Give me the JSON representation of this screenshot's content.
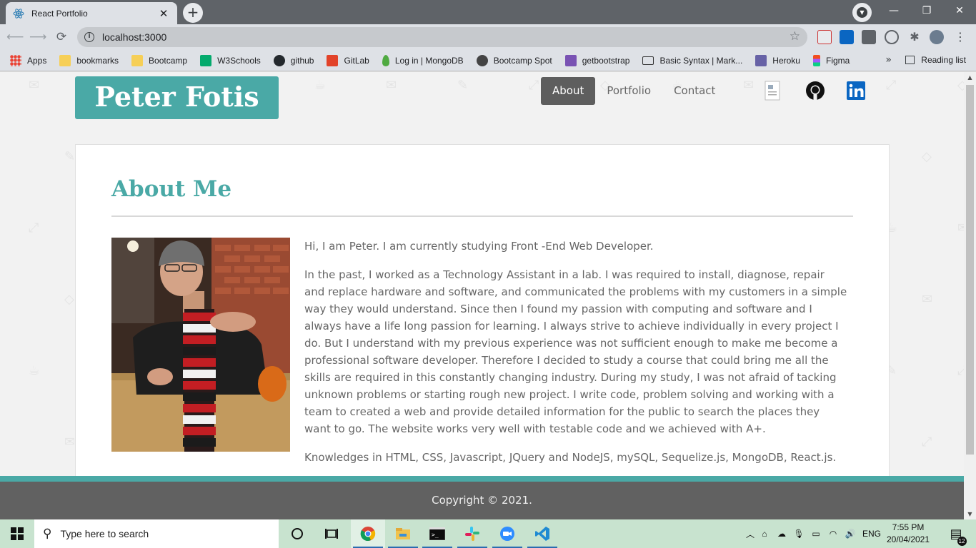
{
  "browser": {
    "tab_title": "React Portfolio",
    "tab_close": "✕",
    "new_tab": "+",
    "url": "localhost:3000",
    "window_controls": {
      "minimize": "—",
      "restore": "❐",
      "close": "✕"
    }
  },
  "bookmarks": [
    {
      "label": "Apps",
      "icon": "apps-grid-icon",
      "color": "#ea4335"
    },
    {
      "label": "bookmarks",
      "icon": "folder-icon",
      "color": "#f6cf57"
    },
    {
      "label": "Bootcamp",
      "icon": "folder-icon",
      "color": "#f6cf57"
    },
    {
      "label": "W3Schools",
      "icon": "w3schools-icon",
      "color": "#04aa6d"
    },
    {
      "label": "github",
      "icon": "github-icon",
      "color": "#24292e"
    },
    {
      "label": "GitLab",
      "icon": "gitlab-icon",
      "color": "#e24329"
    },
    {
      "label": "Log in | MongoDB",
      "icon": "mongodb-icon",
      "color": "#4faa41"
    },
    {
      "label": "Bootcamp Spot",
      "icon": "globe-icon",
      "color": "#444444"
    },
    {
      "label": "getbootstrap",
      "icon": "bootstrap-icon",
      "color": "#7952b3"
    },
    {
      "label": "Basic Syntax | Mark...",
      "icon": "markdown-icon",
      "color": "#333333"
    },
    {
      "label": "Heroku",
      "icon": "heroku-icon",
      "color": "#6762a6"
    },
    {
      "label": "Figma",
      "icon": "figma-icon",
      "color": "#f24e1e"
    }
  ],
  "bookmarks_more": "»",
  "reading_list": "Reading list",
  "site": {
    "brand": "Peter Fotis",
    "nav": [
      {
        "label": "About",
        "active": true
      },
      {
        "label": "Portfolio",
        "active": false
      },
      {
        "label": "Contact",
        "active": false
      }
    ],
    "social": [
      "resume-icon",
      "github-icon",
      "linkedin-icon"
    ]
  },
  "about": {
    "heading": "About Me",
    "paragraphs": [
      "Hi, I am Peter. I am currently studying Front -End Web Developer.",
      "In the past, I worked as a Technology Assistant in a lab. I was required to install, diagnose, repair and replace hardware and software, and communicated the problems with my customers in a simple way they would understand. Since then I found my passion with computing and software and I always have a life long passion for learning. I always strive to achieve individually in every project I do. But I understand with my previous experience was not sufficient enough to make me become a professional software developer. Therefore I decided to study a course that could bring me all the skills are required in this constantly changing industry. During my study, I was not afraid of tacking unknown problems or starting rough new project. I write code, problem solving and working with a team to created a web and provide detailed information for the public to search the places they want to go. The website works very well with testable code and we achieved with A+.",
      "Knowledges in HTML, CSS, Javascript, JQuery and NodeJS, mySQL, Sequelize.js, MongoDB, React.js."
    ]
  },
  "footer": {
    "copyright": "Copyright © 2021."
  },
  "taskbar": {
    "search_placeholder": "Type here to search",
    "language": "ENG",
    "time": "7:55 PM",
    "date": "20/04/2021",
    "notification_count": "12"
  },
  "colors": {
    "accent": "#4aa9a6",
    "nav_active": "#5e5e5e",
    "footer": "#616161",
    "taskbar": "#c8e3cf"
  }
}
